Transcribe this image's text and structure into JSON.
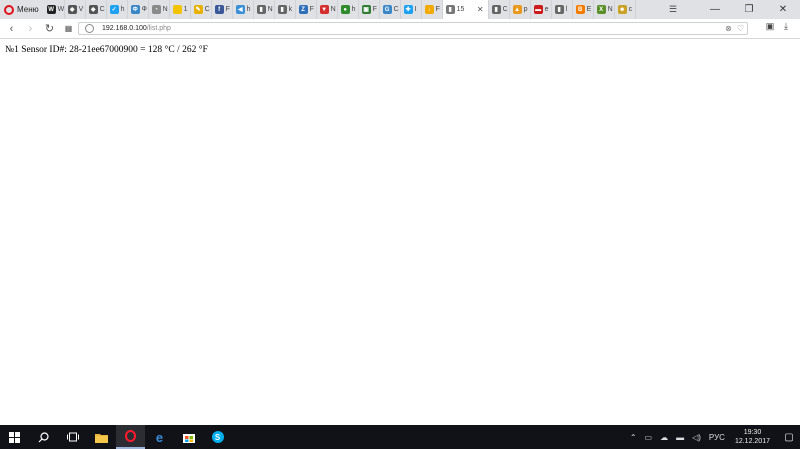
{
  "browser": {
    "menu_label": "Меню",
    "tabs": [
      {
        "label": "W",
        "color": "#222222",
        "glyph": "W"
      },
      {
        "label": "V",
        "color": "#555555",
        "glyph": "◆"
      },
      {
        "label": "C",
        "color": "#555555",
        "glyph": "◆"
      },
      {
        "label": "h",
        "color": "#1da1f2",
        "glyph": "✓"
      },
      {
        "label": "Ф",
        "color": "#3a87c8",
        "glyph": "Ф"
      },
      {
        "label": "N",
        "color": "#8a8a8a",
        "glyph": "◔"
      },
      {
        "label": "1",
        "color": "#f3c300",
        "glyph": ""
      },
      {
        "label": "С",
        "color": "#e8b000",
        "glyph": "✎"
      },
      {
        "label": "F",
        "color": "#3b5998",
        "glyph": "f"
      },
      {
        "label": "h",
        "color": "#3a8fd6",
        "glyph": "◀"
      },
      {
        "label": "N",
        "color": "#666666",
        "glyph": "▮"
      },
      {
        "label": "k",
        "color": "#666666",
        "glyph": "▮"
      },
      {
        "label": "F",
        "color": "#2f6fba",
        "glyph": "Z"
      },
      {
        "label": "N",
        "color": "#d42e2e",
        "glyph": "▼"
      },
      {
        "label": "h",
        "color": "#2e8b2e",
        "glyph": "●"
      },
      {
        "label": "F",
        "color": "#2e7d32",
        "glyph": "▣"
      },
      {
        "label": "C",
        "color": "#3a87c8",
        "glyph": "G"
      },
      {
        "label": "I",
        "color": "#1da1f2",
        "glyph": "✚"
      },
      {
        "label": "F",
        "color": "#f2a900",
        "glyph": "↓"
      }
    ],
    "active_tab": {
      "label": "15",
      "close": "✕"
    },
    "tabs_after": [
      {
        "label": "C",
        "color": "#666666",
        "glyph": "▮"
      },
      {
        "label": "p",
        "color": "#e89a1e",
        "glyph": "▲"
      },
      {
        "label": "e",
        "color": "#cc1b1b",
        "glyph": "▬"
      },
      {
        "label": "l",
        "color": "#666666",
        "glyph": "▮"
      },
      {
        "label": "E",
        "color": "#f57c00",
        "glyph": "B"
      },
      {
        "label": "N",
        "color": "#5b8f29",
        "glyph": "X"
      },
      {
        "label": "c",
        "color": "#c9a227",
        "glyph": "☻"
      }
    ],
    "url_host": "192.168.0.100",
    "url_path": "/list.php"
  },
  "page": {
    "sensor_line": "№1 Sensor ID#: 28-21ee67000900 = 128 °C / 262 °F"
  },
  "taskbar": {
    "lang": "РУС",
    "time": "19:30",
    "date": "12.12.2017"
  }
}
